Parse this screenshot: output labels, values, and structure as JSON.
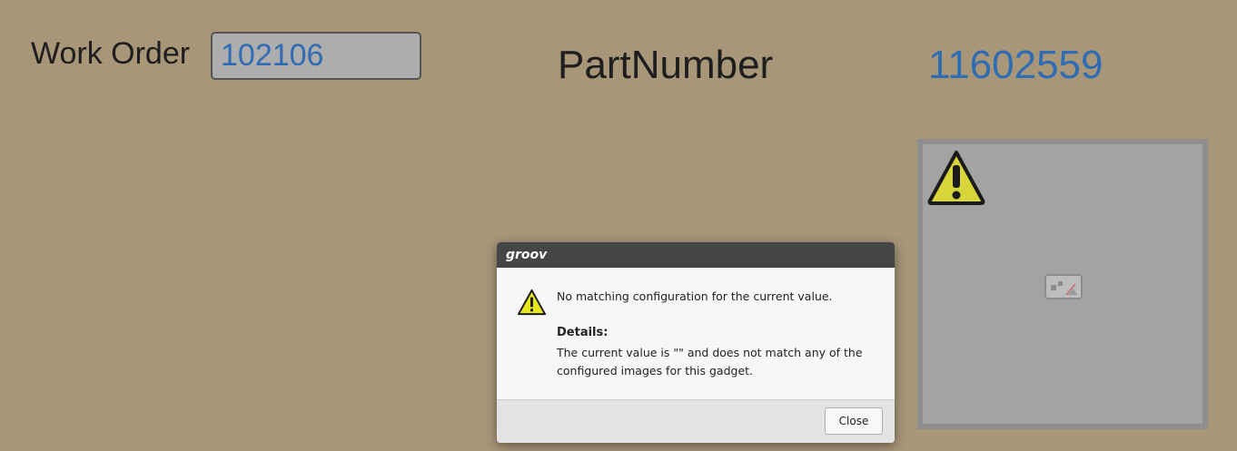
{
  "work_order": {
    "label": "Work Order",
    "value": "102106"
  },
  "part_number": {
    "label": "PartNumber",
    "value": "11602559"
  },
  "image_gadget": {
    "warning_icon": "warning-triangle-icon",
    "placeholder_icon": "broken-image-icon"
  },
  "dialog": {
    "title": "groov",
    "icon": "warning-triangle-icon",
    "message": "No matching configuration for the current value.",
    "details_title": "Details:",
    "details_text": "The current value is \"\" and does not match any of the configured images for this gadget.",
    "close_label": "Close"
  },
  "colors": {
    "background": "#a89679",
    "value_blue": "#2f6cb3",
    "warning_yellow": "#d7d53a",
    "dialog_header": "#454545"
  }
}
